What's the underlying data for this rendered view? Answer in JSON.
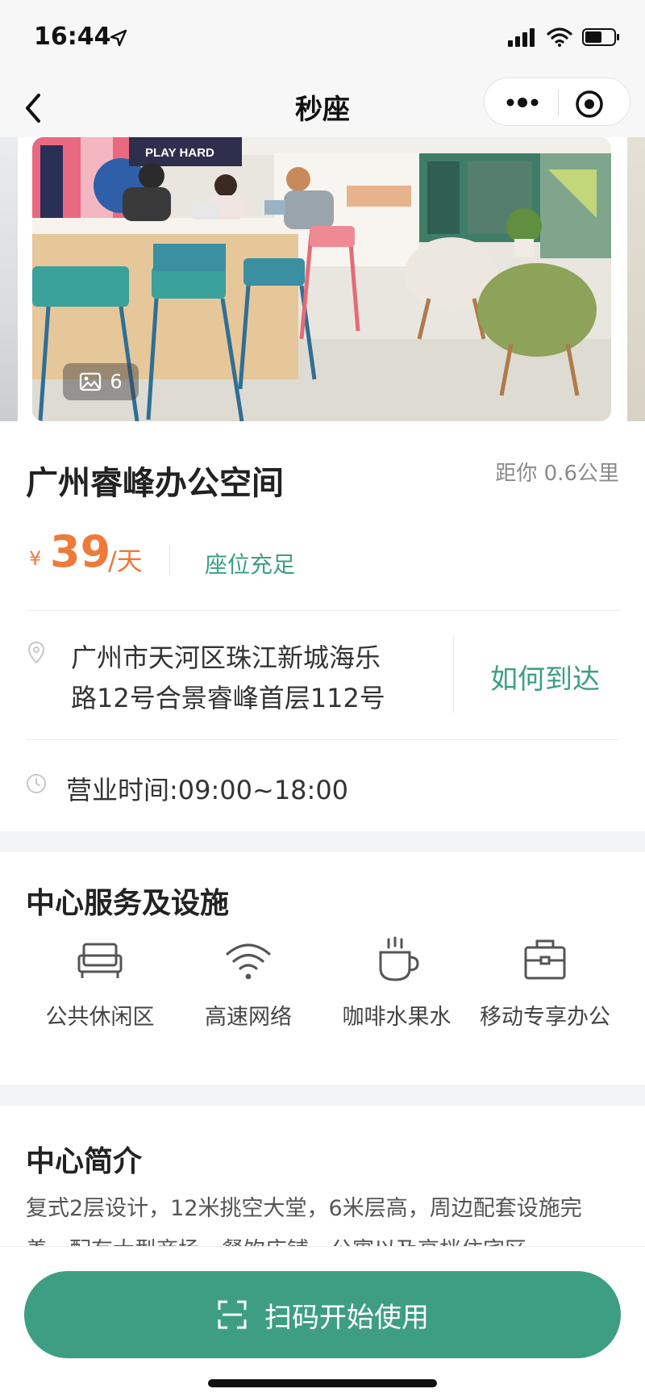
{
  "status_bar": {
    "time": "16:44"
  },
  "nav": {
    "title": "秒座"
  },
  "carousel": {
    "photo_count": "6",
    "sign_text": "PLAY HARD"
  },
  "space": {
    "name": "广州睿峰办公空间",
    "distance": "距你 0.6公里",
    "price_symbol": "¥",
    "price_value": "39",
    "price_unit": "/天",
    "seat_status": "座位充足",
    "address_line1": "广州市天河区珠江新城海乐",
    "address_line2": "路12号合景睿峰首层112号",
    "route_label": "如何到达",
    "hours": "营业时间:09:00~18:00"
  },
  "facilities": {
    "title": "中心服务及设施",
    "items": [
      {
        "label": "公共休闲区",
        "icon": "sofa-icon"
      },
      {
        "label": "高速网络",
        "icon": "wifi-icon"
      },
      {
        "label": "咖啡水果水",
        "icon": "coffee-cup-icon"
      },
      {
        "label": "移动专享办公",
        "icon": "briefcase-icon"
      }
    ]
  },
  "intro": {
    "title": "中心简介",
    "line1": "复式2层设计，12米挑空大堂，6米层高，周边配套设施完",
    "line2": "善、配有大型商场、餐饮店铺、公寓以及高档住宅区"
  },
  "action": {
    "scan_label": "扫码开始使用"
  },
  "colors": {
    "accent": "#3e9e84",
    "price": "#ee7a3a",
    "divider": "#ececec"
  }
}
